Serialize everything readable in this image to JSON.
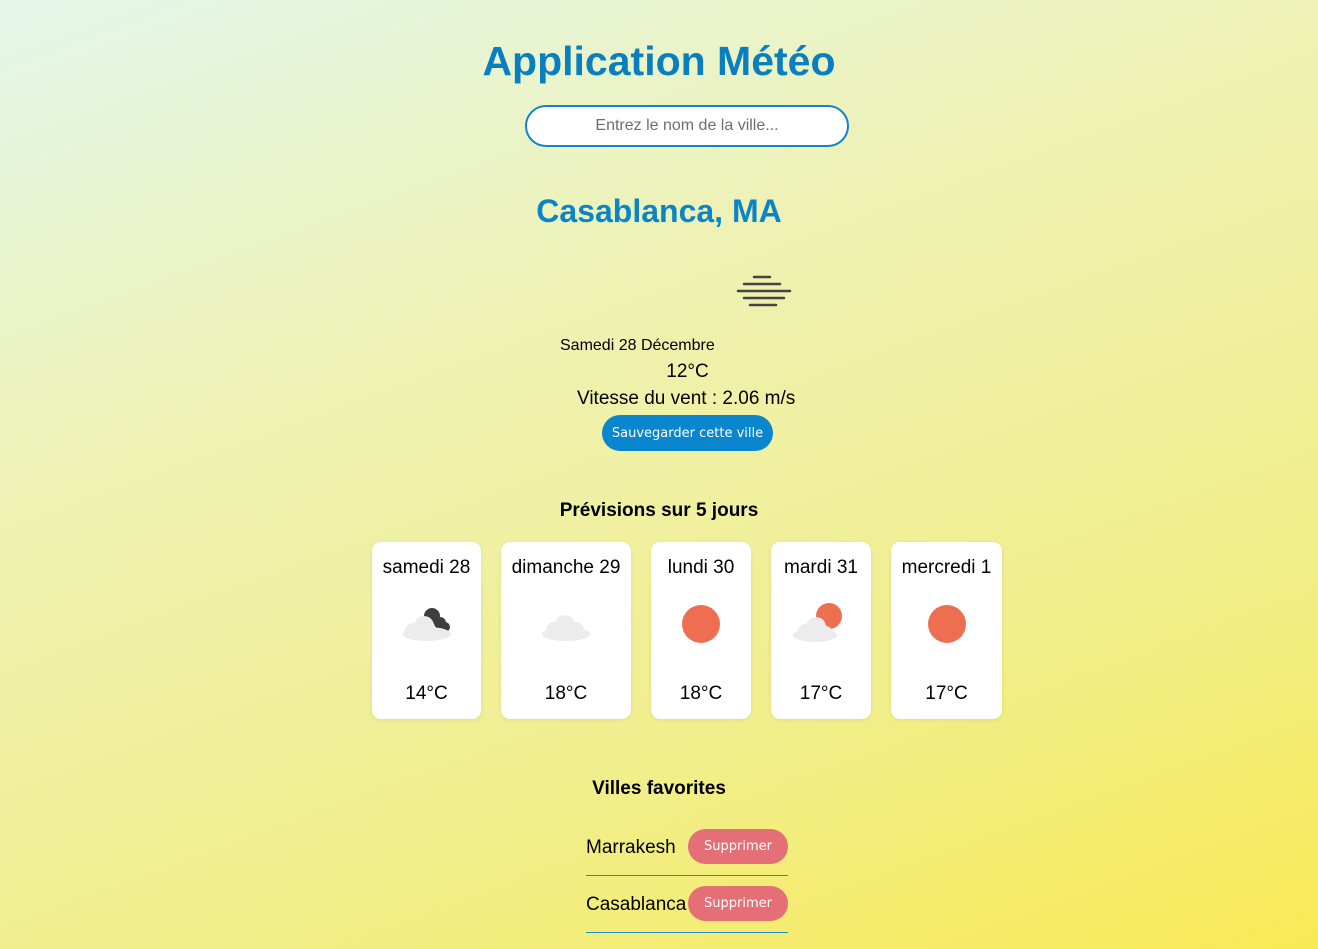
{
  "header": {
    "title": "Application Météo"
  },
  "search": {
    "placeholder": "Entrez le nom de la ville..."
  },
  "current": {
    "city": "Casablanca, MA",
    "icon": "mist-icon",
    "date": "Samedi 28 Décembre",
    "temperature": "12°C",
    "wind": "Vitesse du vent : 2.06 m/s",
    "save_label": "Sauvegarder cette ville"
  },
  "forecast": {
    "title": "Prévisions sur 5 jours",
    "days": [
      {
        "day": "samedi 28",
        "icon": "partly-cloudy-night-icon",
        "temp": "14°C"
      },
      {
        "day": "dimanche 29",
        "icon": "cloud-icon",
        "temp": "18°C"
      },
      {
        "day": "lundi 30",
        "icon": "sun-icon",
        "temp": "18°C"
      },
      {
        "day": "mardi 31",
        "icon": "partly-sunny-icon",
        "temp": "17°C"
      },
      {
        "day": "mercredi 1",
        "icon": "sun-icon",
        "temp": "17°C"
      }
    ]
  },
  "favorites": {
    "title": "Villes favorites",
    "delete_label": "Supprimer",
    "items": [
      {
        "name": "Marrakesh"
      },
      {
        "name": "Casablanca"
      }
    ]
  },
  "colors": {
    "accent": "#0a86cf",
    "title": "#0a7fc0",
    "delete": "#e56f77",
    "sun": "#ee6e52"
  }
}
